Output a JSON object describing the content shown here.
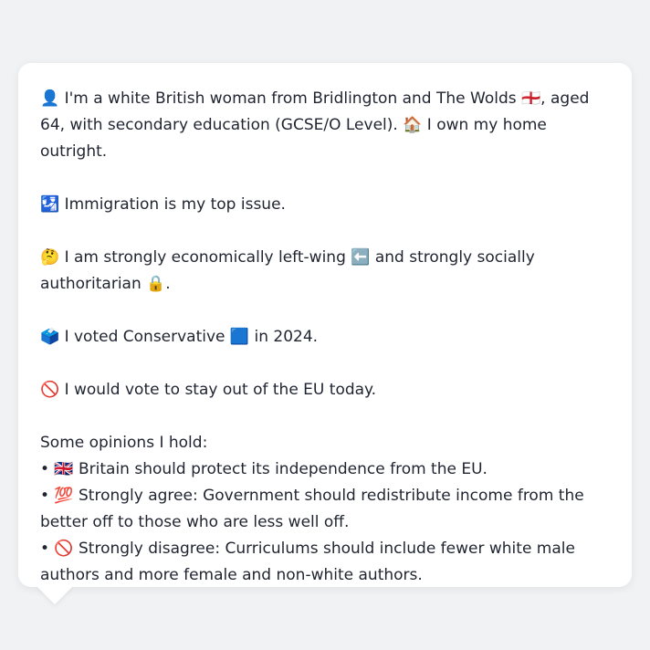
{
  "profile": {
    "intro": "👤 I'm a white British woman from Bridlington and The Wolds 🏴󠁧󠁢󠁥󠁮󠁧󠁿, aged 64, with secondary education (GCSE/O Level). 🏠 I own my home outright.",
    "top_issue": "🛂 Immigration is my top issue.",
    "ideology": "🤔 I am strongly economically left-wing ⬅️ and strongly socially authoritarian 🔒.",
    "vote_2024": "🗳️ I voted Conservative 🟦 in 2024.",
    "eu_vote": "🚫 I would vote to stay out of the EU today."
  },
  "opinions": {
    "heading": "Some opinions I hold:",
    "items": [
      "• 🇬🇧 Britain should protect its independence from the EU.",
      "• 💯 Strongly agree: Government should redistribute income from the better off to those who are less well off.",
      "• 🚫 Strongly disagree: Curriculums should include fewer white male authors and more female and non-white authors."
    ]
  }
}
